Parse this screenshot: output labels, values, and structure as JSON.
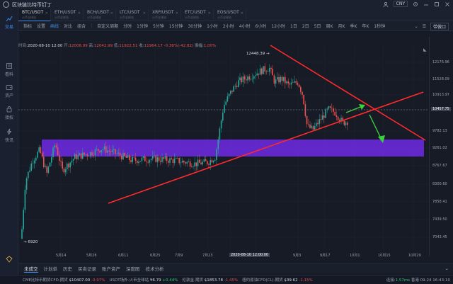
{
  "titlebar": {
    "title": "区块链比特币钉丁",
    "currency": "CNY",
    "icons": [
      "user-icon",
      "settings-icon",
      "minimize-icon",
      "maximize-icon",
      "close-icon"
    ]
  },
  "sidebar": {
    "items": [
      {
        "label": "交易",
        "icon": "chart-icon",
        "active": true
      },
      {
        "label": "看料",
        "icon": "news-icon"
      },
      {
        "label": "资产",
        "icon": "wallet-icon"
      },
      {
        "label": "接权",
        "icon": "link-icon"
      },
      {
        "label": "快讯",
        "icon": "flash-icon"
      }
    ]
  },
  "tabs": [
    {
      "label": "BTC/USDT",
      "sub": "火币全球站",
      "active": true
    },
    {
      "label": "ETH/USDT",
      "sub": "火币全球站"
    },
    {
      "label": "BCH/USDT",
      "sub": "火币全球站"
    },
    {
      "label": "LTC/USDT",
      "sub": "火币全球站"
    },
    {
      "label": "XRP/USDT",
      "sub": "火币全球站"
    },
    {
      "label": "ETC/USDT",
      "sub": "火币全球站"
    },
    {
      "label": "EOS/USDT",
      "sub": "火币全球站"
    }
  ],
  "toolbar": {
    "items": [
      "指标",
      "设置",
      "画线",
      "对比",
      "组合",
      "自定义周期",
      "分时",
      "1分钟",
      "5分钟",
      "15分钟",
      "30分钟",
      "1小时",
      "2小时",
      "4小时",
      "6小时",
      "12小时",
      "1日",
      "2日",
      "5日",
      "周K",
      "月K",
      "季K",
      "年K",
      "1秒钟"
    ],
    "active": "画线",
    "right_label": "带做口"
  },
  "info": {
    "time_label": "时间:",
    "time": "2020-08-10 12:00",
    "open_label": "开:",
    "open": "12006.99",
    "high_label": "高:",
    "high": "12042.99",
    "low_label": "低:",
    "low": "11922.51",
    "close_label": "收:",
    "close": "11964.17",
    "change": "-0.36%(-42.82)",
    "amp_label": "振幅:",
    "amp": "1.00%"
  },
  "chart_data": {
    "type": "candlestick",
    "pair": "BTC/USDT",
    "y_ticks": [
      "12176.96",
      "11528.09",
      "10913.97",
      "10457.75",
      "9782.13",
      "9261.02",
      "8767.67",
      "8300.60",
      "7858.41",
      "7439.50",
      "7043.45"
    ],
    "current_price": "10457.75",
    "x_ticks": [
      "5月14",
      "5月28",
      "6月11",
      "6月25",
      "7月9",
      "7月23",
      "2020-08-10 12:00:00",
      "9月3",
      "9月17",
      "10月1",
      "10月15",
      "10月29"
    ],
    "annotations": {
      "high_label": "12448.39",
      "low_label": "6920"
    },
    "colors": {
      "up": "#26a69a",
      "down": "#ef5350",
      "zone": "#7b2cff",
      "trendline": "#ff2a2a",
      "arrow": "#3ccf3c"
    }
  },
  "bottom_tabs": {
    "items": [
      "未成交",
      "计划单",
      "历史",
      "买卖记录",
      "账户资产",
      "深度图",
      "技术分析"
    ],
    "active": "未成交"
  },
  "ticker": {
    "items": [
      {
        "name": "CME比特币期货CFD-期货",
        "price": "$10407.00",
        "change": "-0.97%",
        "dir": "down"
      },
      {
        "name": "USDT场外-火币全球站",
        "price": "¥6.79",
        "change": "+0.44%",
        "dir": "up"
      },
      {
        "name": "伦敦金-期货",
        "price": "$1853.78",
        "change": "-1.45%",
        "dir": "down"
      },
      {
        "name": "纽约原油CFD(CL)-期货",
        "price": "$39.62",
        "change": "-1.15%",
        "dir": "down"
      }
    ],
    "latency_label": "连接:",
    "latency": "1.57ms",
    "clock": "香港 09-24 16:43:10"
  }
}
